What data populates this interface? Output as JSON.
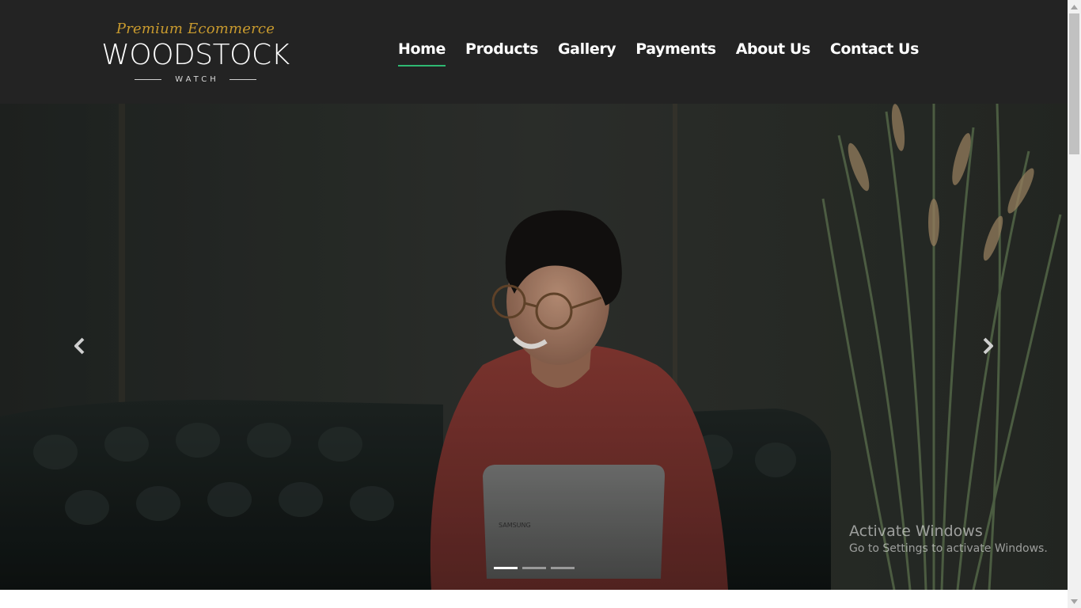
{
  "brand": {
    "tagline": "Premium Ecommerce",
    "name": "WOODSTOCK",
    "sub": "WATCH"
  },
  "nav": {
    "items": [
      {
        "label": "Home",
        "active": true
      },
      {
        "label": "Products"
      },
      {
        "label": "Gallery"
      },
      {
        "label": "Payments"
      },
      {
        "label": "About Us"
      },
      {
        "label": "Contact Us"
      }
    ],
    "active_color": "#2eb872"
  },
  "hero": {
    "image": "woman-smiling-with-laptop-on-leather-sofa-photo",
    "prev_icon": "chevron-left-icon",
    "next_icon": "chevron-right-icon",
    "slide_count": 3,
    "active_slide": 1
  },
  "watermark": {
    "title": "Activate Windows",
    "subtitle": "Go to Settings to activate Windows."
  },
  "colors": {
    "header_bg": "#232323",
    "accent": "#2eb872",
    "tagline": "#c89a2e"
  }
}
